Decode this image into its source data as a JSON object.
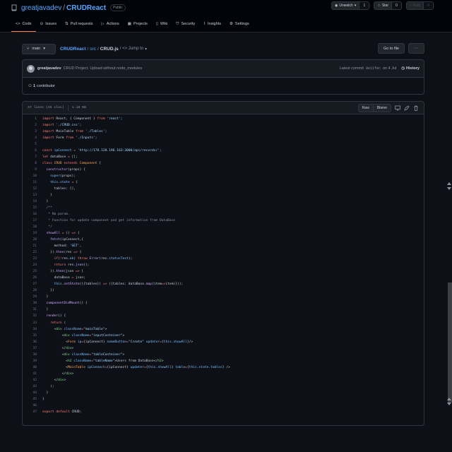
{
  "repo": {
    "owner": "greatjavadev",
    "slash": "/",
    "name": "CRUDReact",
    "visibility": "Public"
  },
  "header_buttons": [
    {
      "icon": "eye-icon",
      "label": "Unwatch",
      "count": "1",
      "disabled": false
    },
    {
      "icon": "star-icon",
      "label": "Star",
      "count": "0",
      "disabled": false
    },
    {
      "icon": "fork-icon",
      "label": "Fork",
      "count": "0",
      "disabled": true
    }
  ],
  "tabs": [
    {
      "label": "Code",
      "icon": "code-icon",
      "active": true
    },
    {
      "label": "Issues",
      "icon": "issue-icon"
    },
    {
      "label": "Pull requests",
      "icon": "pull-request-icon"
    },
    {
      "label": "Actions",
      "icon": "play-icon"
    },
    {
      "label": "Projects",
      "icon": "table-icon"
    },
    {
      "label": "Wiki",
      "icon": "book-icon"
    },
    {
      "label": "Security",
      "icon": "shield-icon"
    },
    {
      "label": "Insights",
      "icon": "graph-icon"
    },
    {
      "label": "Settings",
      "icon": "gear-icon"
    }
  ],
  "nav": {
    "branch": "main",
    "crumb_repo": "CRUDReact",
    "crumb_sep": "/",
    "crumb_dir": "src",
    "crumb_file": "CRUD.js",
    "jump": "/ <> Jump to",
    "goto_file": "Go to file",
    "more": "···"
  },
  "commit": {
    "author": "greatjavadev",
    "message": "CRUD Project. Upload without node_modules",
    "latest_label": "Latest commit",
    "sha": "8e11fec",
    "date": "on 4 Jul",
    "history": "History"
  },
  "contributors": {
    "count": "1",
    "label": "contributor"
  },
  "file": {
    "stats": "47 lines (45 sloc)",
    "size": "1.18 KB",
    "raw": "Raw",
    "blame": "Blame"
  },
  "code_lines": [
    "<span class=\"k\">import</span> React, { Component } <span class=\"k\">from</span> <span class=\"s\">'react'</span>;",
    "<span class=\"k\">import</span> <span class=\"s\">'./CRUD.css'</span>;",
    "<span class=\"k\">import</span> MainTable <span class=\"k\">from</span> <span class=\"s\">'./Tables'</span>;",
    "<span class=\"k\">import</span> Form <span class=\"k\">from</span> <span class=\"s\">'./Inputs'</span>;",
    "",
    "<span class=\"k\">const</span> <span class=\"v\">ipConnect</span> <span class=\"k\">=</span> <span class=\"s\">'http://178.128.196.163:3000/api/records/'</span>;",
    "<span class=\"k\">let</span> dataBase <span class=\"k\">=</span> [];",
    "<span class=\"k\">class</span> <span class=\"cl\">CRUD</span> <span class=\"k\">extends</span> <span class=\"cl\">Component</span> {",
    "  <span class=\"f\">constructor</span>(props) {",
    "    <span class=\"v\">super</span>(props);",
    "    <span class=\"v\">this</span>.<span class=\"v\">state</span> <span class=\"k\">=</span> {",
    "      tables: [],",
    "    }",
    "  }",
    "  <span class=\"c\">/**</span>",
    "<span class=\"c\">   * No param.</span>",
    "<span class=\"c\">   * Function for update component and get information from DataBase</span>",
    "<span class=\"c\">   */</span>",
    "  <span class=\"f\">showAll</span> <span class=\"k\">=</span> () <span class=\"k\">=&gt;</span> {",
    "    <span class=\"f\">fetch</span>(ipConnect,{",
    "      method: <span class=\"s\">'GET'</span>,",
    "    }).<span class=\"f\">then</span>(res <span class=\"k\">=&gt;</span> {",
    "      <span class=\"k\">if</span>(<span class=\"k\">!</span>res.<span class=\"v\">ok</span>) <span class=\"k\">throw</span> <span class=\"f\">Error</span>(res.<span class=\"v\">statusText</span>);",
    "      <span class=\"k\">return</span> res.<span class=\"f\">json</span>();",
    "    }).<span class=\"f\">then</span>(json <span class=\"k\">=&gt;</span> {",
    "      dataBase <span class=\"k\">=</span> json;",
    "      <span class=\"v\">this</span>.<span class=\"f\">setState</span>(({tables}) <span class=\"k\">=&gt;</span> ({tables: dataBase.<span class=\"f\">map</span>(item<span class=\"k\">=&gt;</span>item)}));",
    "    })",
    "  }",
    "  <span class=\"f\">componentDidMount</span>() {",
    "  }",
    "  <span class=\"f\">render</span>() {",
    "    <span class=\"k\">return</span> (",
    "      &lt;<span class=\"t\">div</span> <span class=\"v\">className</span><span class=\"k\">=</span><span class=\"s\">\"mainTable\"</span>&gt;",
    "          &lt;<span class=\"t\">div</span> <span class=\"v\">className</span><span class=\"k\">=</span><span class=\"s\">\"inputConteiner\"</span>&gt;",
    "            &lt;<span class=\"cl\">Form</span> <span class=\"v\">ip</span><span class=\"k\">=</span>{ipConnect} <span class=\"v\">nameButton</span><span class=\"k\">=</span><span class=\"s\">\"Create\"</span> <span class=\"v\">updater</span><span class=\"k\">=</span>{<span class=\"v\">this</span>.<span class=\"v\">showAll</span>}/&gt;",
    "          &lt;/<span class=\"t\">div</span>&gt;",
    "          &lt;<span class=\"t\">div</span> <span class=\"v\">className</span><span class=\"k\">=</span><span class=\"s\">\"tableConteiner\"</span>&gt;",
    "            &lt;<span class=\"t\">h2</span> <span class=\"v\">className</span><span class=\"k\">=</span><span class=\"s\">\"tableName\"</span>&gt;Users from DataBase&lt;/<span class=\"t\">h2</span>&gt;",
    "            &lt;<span class=\"cl\">MainTable</span> <span class=\"v\">ipConnect</span><span class=\"k\">=</span>{ipConnect} <span class=\"v\">updater</span><span class=\"k\">=</span>{<span class=\"v\">this</span>.<span class=\"v\">showAll</span>} <span class=\"v\">table</span><span class=\"k\">=</span>{<span class=\"v\">this</span>.<span class=\"v\">state</span>.<span class=\"v\">tables</span>} /&gt;",
    "          &lt;/<span class=\"t\">div</span>&gt;",
    "      &lt;/<span class=\"t\">div</span>&gt;",
    "    );",
    "  }",
    "}",
    "",
    "<span class=\"k\">export</span> <span class=\"k\">default</span> CRUD;"
  ]
}
